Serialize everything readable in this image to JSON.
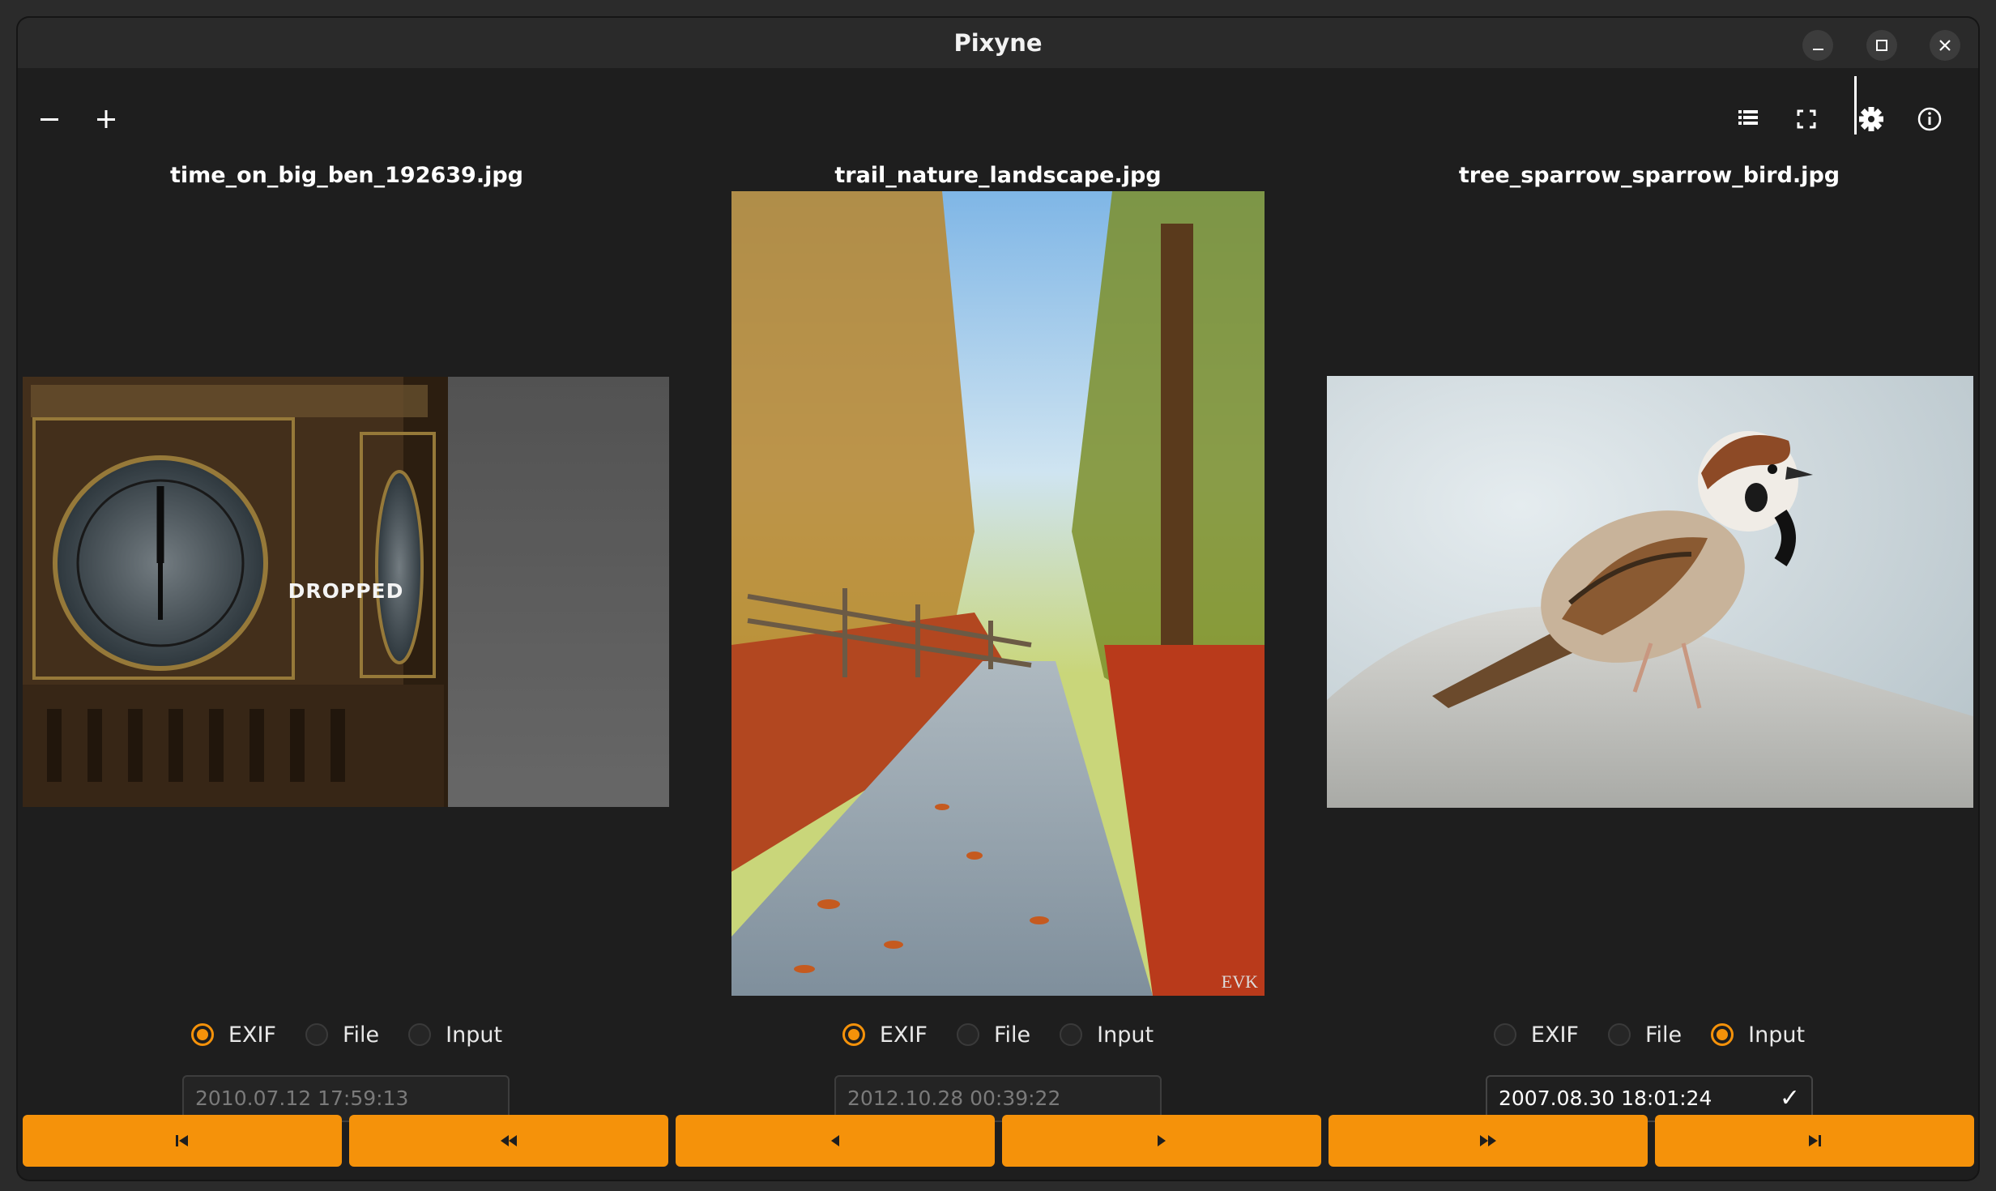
{
  "window": {
    "title": "Pixyne"
  },
  "toolbar": {
    "zoom_out_icon": "minus-icon",
    "zoom_in_icon": "plus-icon",
    "list_icon": "list-icon",
    "fullscreen_icon": "fullscreen-icon",
    "settings_icon": "gear-icon",
    "info_icon": "info-icon"
  },
  "photos": [
    {
      "filename": "time_on_big_ben_192639.jpg",
      "overlay": "DROPPED",
      "source_options": [
        "EXIF",
        "File",
        "Input"
      ],
      "selected_source": "EXIF",
      "date": "2010.07.12 17:59:13"
    },
    {
      "filename": "trail_nature_landscape.jpg",
      "overlay": "",
      "watermark": "EVK",
      "source_options": [
        "EXIF",
        "File",
        "Input"
      ],
      "selected_source": "EXIF",
      "date": "2012.10.28 00:39:22"
    },
    {
      "filename": "tree_sparrow_sparrow_bird.jpg",
      "overlay": "",
      "source_options": [
        "EXIF",
        "File",
        "Input"
      ],
      "selected_source": "Input",
      "date": "2007.08.30 18:01:24"
    }
  ],
  "navigation": [
    {
      "icon": "skip-first-icon"
    },
    {
      "icon": "fast-rewind-icon"
    },
    {
      "icon": "previous-icon"
    },
    {
      "icon": "next-icon"
    },
    {
      "icon": "fast-forward-icon"
    },
    {
      "icon": "skip-last-icon"
    }
  ],
  "colors": {
    "accent": "#f5920a",
    "background": "#1e1e1e",
    "titlebar": "#2a2a2a"
  }
}
